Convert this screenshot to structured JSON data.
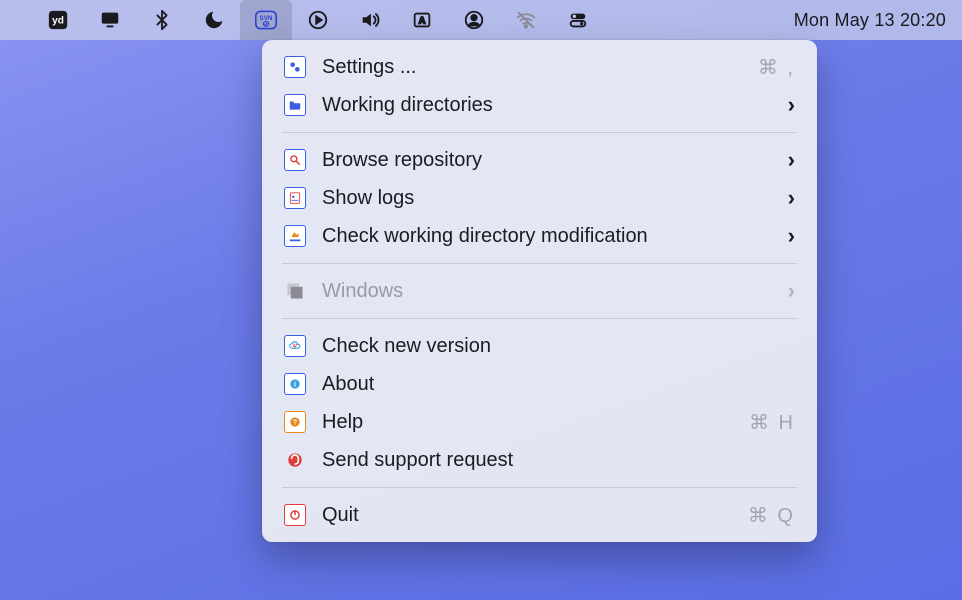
{
  "menubar": {
    "clock": "Mon May 13  20:20",
    "active_item": "svn-icon"
  },
  "menu": {
    "group1": [
      {
        "icon": "settings-gears-icon",
        "label": "Settings ...",
        "shortcut": "⌘ ,",
        "submenu": false
      },
      {
        "icon": "folder-icon",
        "label": "Working directories",
        "shortcut": "",
        "submenu": true
      }
    ],
    "group2": [
      {
        "icon": "browse-repo-icon",
        "label": "Browse repository",
        "shortcut": "",
        "submenu": true
      },
      {
        "icon": "show-logs-icon",
        "label": "Show logs",
        "shortcut": "",
        "submenu": true
      },
      {
        "icon": "check-mod-icon",
        "label": "Check working directory modification",
        "shortcut": "",
        "submenu": true
      }
    ],
    "group3": [
      {
        "icon": "windows-icon",
        "label": "Windows",
        "shortcut": "",
        "submenu": true,
        "disabled": true
      }
    ],
    "group4": [
      {
        "icon": "cloud-check-icon",
        "label": "Check new version",
        "shortcut": "",
        "submenu": false
      },
      {
        "icon": "info-icon",
        "label": "About",
        "shortcut": "",
        "submenu": false
      },
      {
        "icon": "help-icon",
        "label": "Help",
        "shortcut": "⌘ H",
        "submenu": false
      },
      {
        "icon": "support-icon",
        "label": "Send support request",
        "shortcut": "",
        "submenu": false
      }
    ],
    "group5": [
      {
        "icon": "power-icon",
        "label": "Quit",
        "shortcut": "⌘ Q",
        "submenu": false
      }
    ]
  }
}
